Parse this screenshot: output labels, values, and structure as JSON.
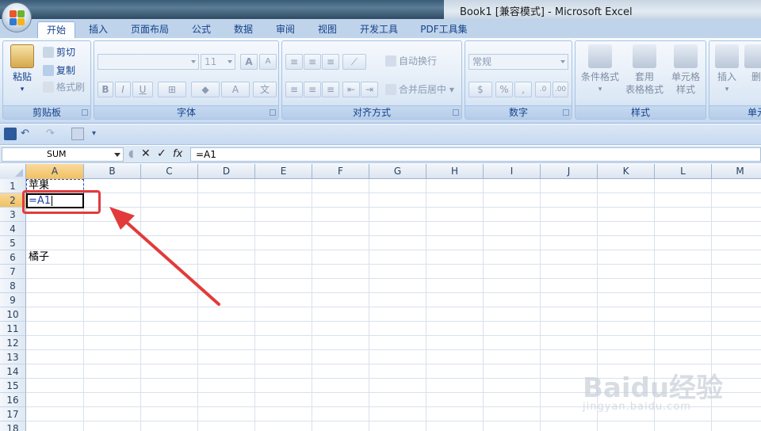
{
  "window": {
    "title": "Book1  [兼容模式]  -  Microsoft Excel"
  },
  "tabs": [
    "开始",
    "插入",
    "页面布局",
    "公式",
    "数据",
    "审阅",
    "视图",
    "开发工具",
    "PDF工具集"
  ],
  "active_tab": "开始",
  "ribbon": {
    "clipboard": {
      "label": "剪贴板",
      "paste": "粘贴",
      "cut": "剪切",
      "copy": "复制",
      "format_painter": "格式刷"
    },
    "font": {
      "label": "字体",
      "font_name": "",
      "font_size": "11"
    },
    "alignment": {
      "label": "对齐方式",
      "wrap_text": "自动换行",
      "merge_center": "合并后居中"
    },
    "number": {
      "label": "数字",
      "format": "常规",
      "percent": "%",
      "comma": ","
    },
    "styles": {
      "label": "样式",
      "conditional": "条件格式",
      "table_format_1": "套用",
      "table_format_2": "表格格式",
      "cell_styles_1": "单元格",
      "cell_styles_2": "样式"
    },
    "cells": {
      "label": "单元",
      "insert": "插入",
      "delete": "删"
    }
  },
  "formula_bar": {
    "name_box": "SUM",
    "cancel": "✕",
    "enter": "✓",
    "fx": "fx",
    "formula": "=A1"
  },
  "columns": [
    "A",
    "B",
    "C",
    "D",
    "E",
    "F",
    "G",
    "H",
    "I",
    "J",
    "K",
    "L",
    "M"
  ],
  "rows": [
    "1",
    "2",
    "3",
    "4",
    "5",
    "6",
    "7",
    "8",
    "9",
    "10",
    "11",
    "12",
    "13",
    "14",
    "15",
    "16",
    "17",
    "18"
  ],
  "cells": {
    "A1": "苹果",
    "A2": "=A1",
    "A6": "橘子"
  },
  "watermark": {
    "main": "Baidu经验",
    "sub": "jingyan.baidu.com"
  },
  "colors": {
    "annotation": "#e23b3b",
    "ribbon_blue": "#15428b",
    "selected_header": "#f1c15f"
  }
}
